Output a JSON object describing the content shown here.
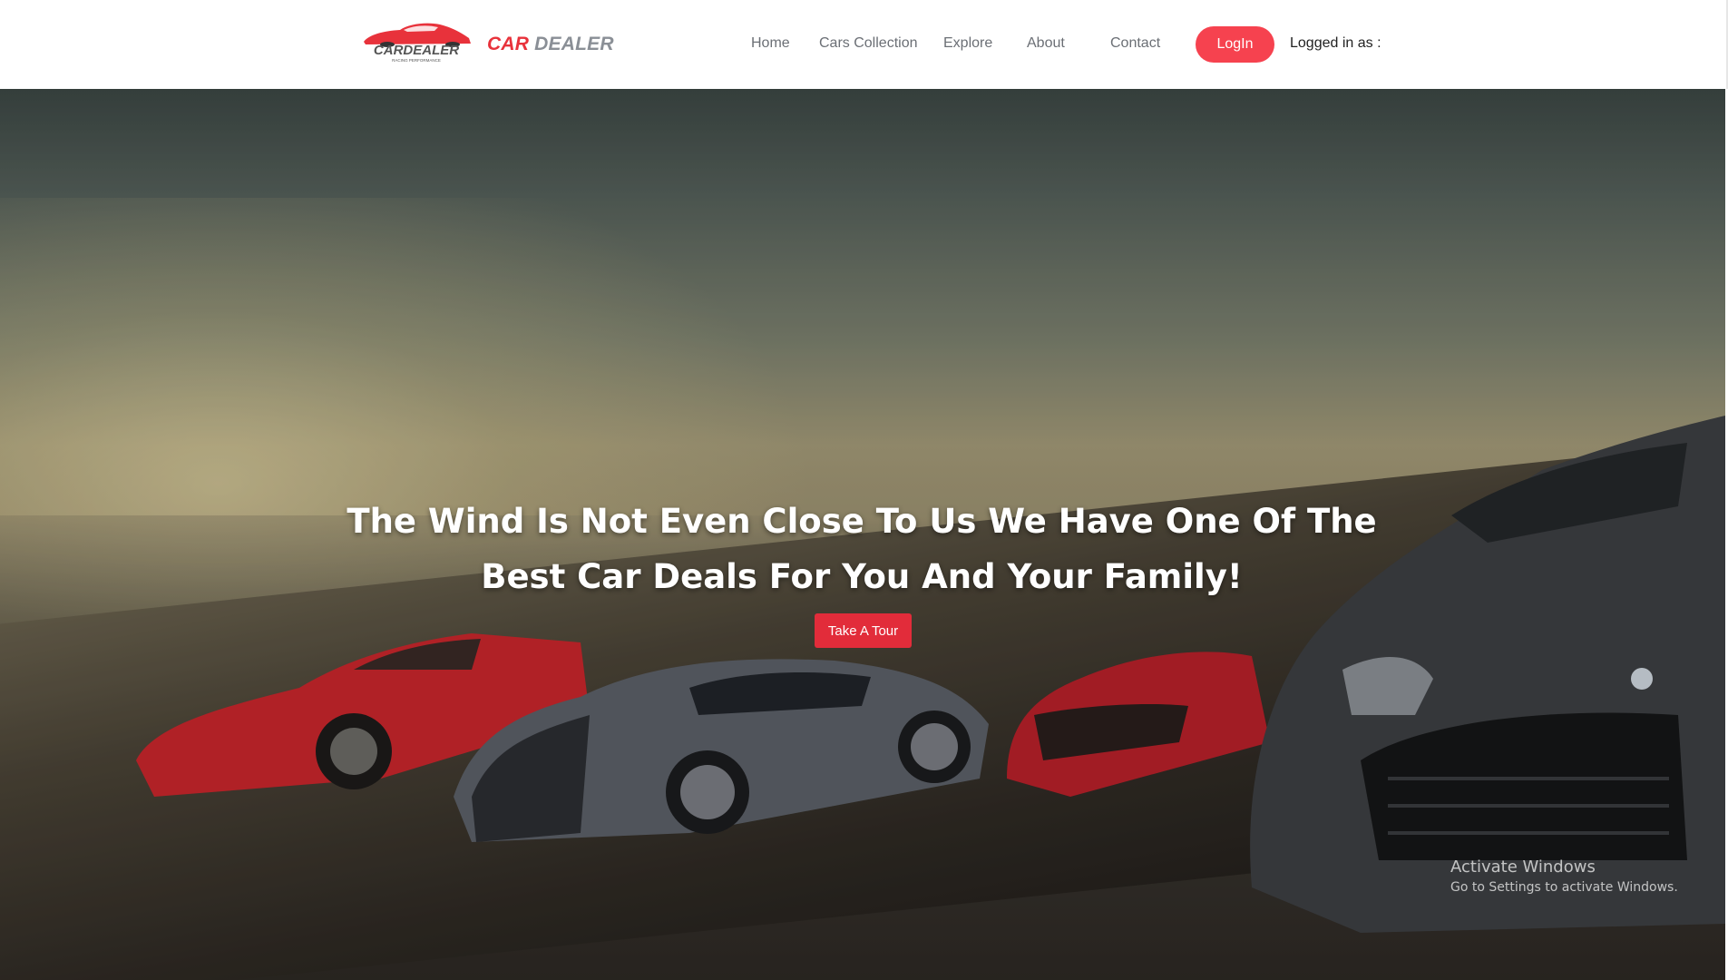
{
  "header": {
    "logo_text": "CARDEALER",
    "logo_tagline": "RACING PERFORMANCE",
    "brand_part1": "CAR",
    "brand_part2": "DEALER",
    "nav": [
      {
        "label": "Home"
      },
      {
        "label": "Cars Collection"
      },
      {
        "label": "Explore"
      },
      {
        "label": "About"
      },
      {
        "label": "Contact"
      }
    ],
    "login_label": "LogIn",
    "logged_in_label": "Logged in as :"
  },
  "hero": {
    "headline": "The Wind Is Not Even Close To Us We Have One Of The Best Car Deals For You And Your Family!",
    "cta_label": "Take A Tour"
  },
  "os_watermark": {
    "title": "Activate Windows",
    "subtitle": "Go to Settings to activate Windows."
  },
  "colors": {
    "accent": "#f6424f",
    "cta": "#e22c3a",
    "brand_red": "#e8323b",
    "brand_grey": "#8a8f96"
  }
}
